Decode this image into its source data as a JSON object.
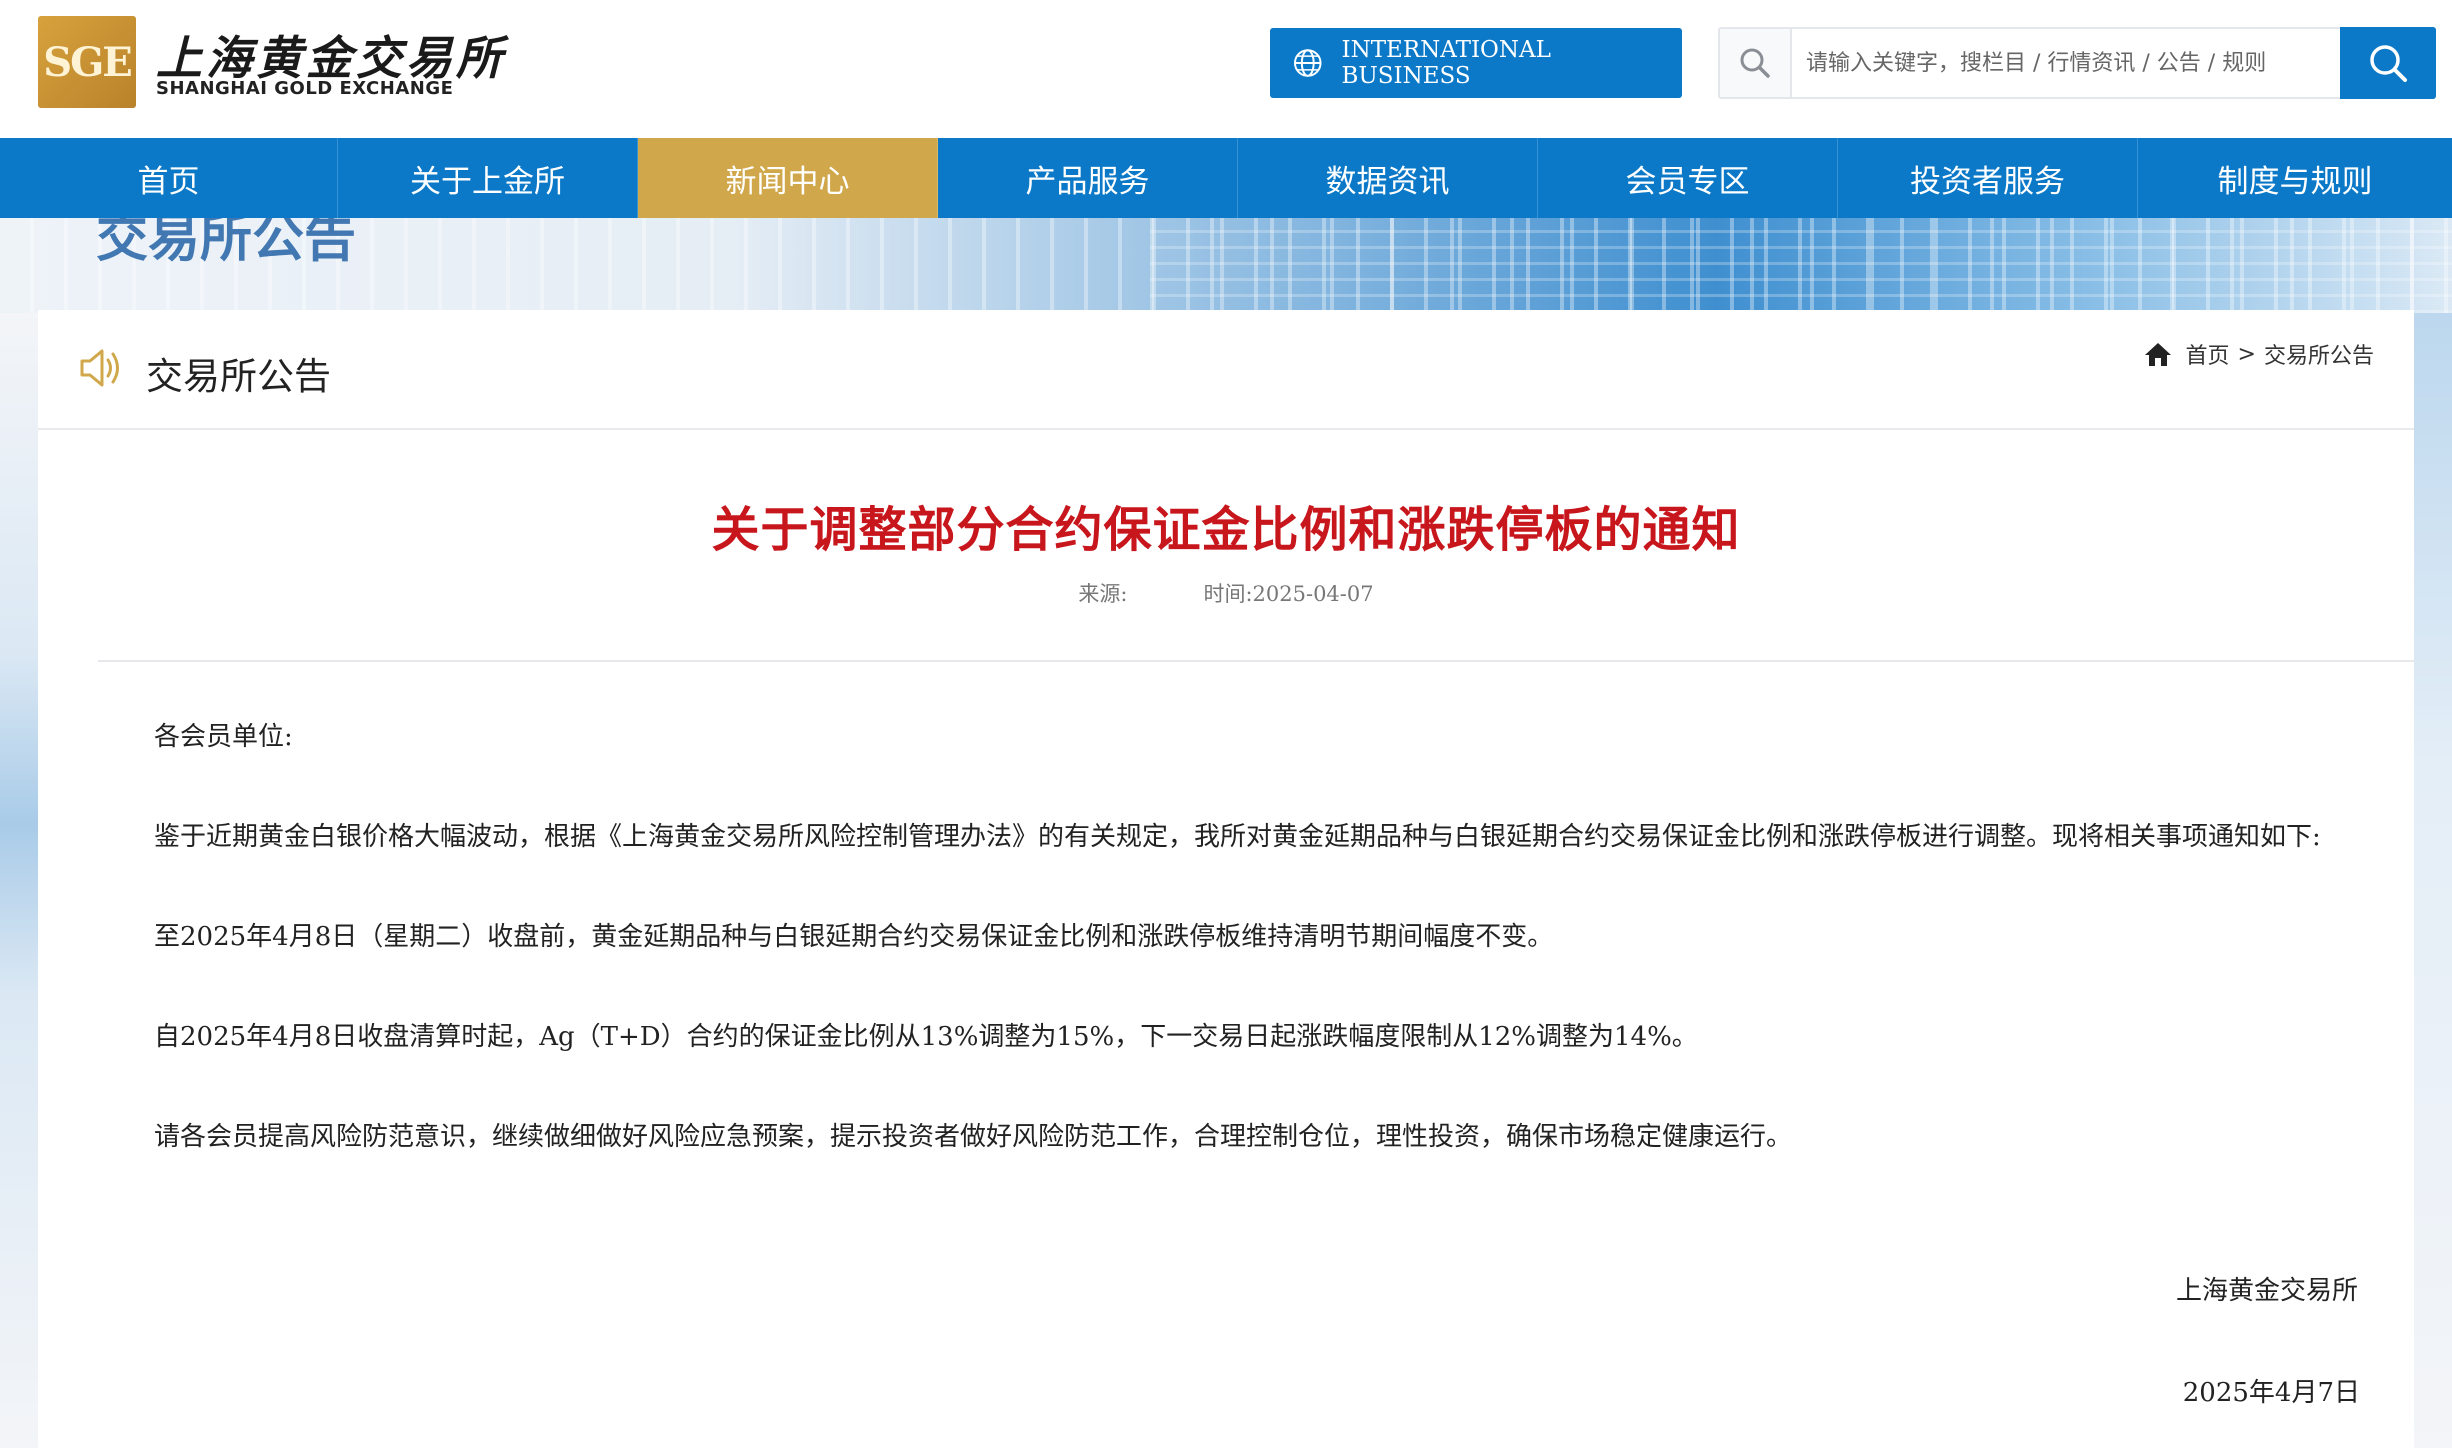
{
  "header": {
    "logo_mark": "SGE",
    "logo_cn": "上海黄金交易所",
    "logo_en": "SHANGHAI GOLD EXCHANGE",
    "intl_button": "INTERNATIONAL BUSINESS",
    "search_placeholder": "请输入关键字，搜栏目 / 行情资讯 / 公告 / 规则"
  },
  "nav": {
    "items": [
      {
        "label": "首页"
      },
      {
        "label": "关于上金所"
      },
      {
        "label": "新闻中心"
      },
      {
        "label": "产品服务"
      },
      {
        "label": "数据资讯"
      },
      {
        "label": "会员专区"
      },
      {
        "label": "投资者服务"
      },
      {
        "label": "制度与规则"
      }
    ],
    "active_index": 2
  },
  "banner": {
    "title": "交易所公告"
  },
  "section": {
    "title": "交易所公告",
    "breadcrumb": {
      "home": "首页",
      "separator": ">",
      "current": "交易所公告"
    }
  },
  "article": {
    "title": "关于调整部分合约保证金比例和涨跌停板的通知",
    "source_label": "来源:",
    "time_label": "时间:2025-04-07",
    "salutation": "各会员单位:",
    "paragraphs": [
      "鉴于近期黄金白银价格大幅波动，根据《上海黄金交易所风险控制管理办法》的有关规定，我所对黄金延期品种与白银延期合约交易保证金比例和涨跌停板进行调整。现将相关事项通知如下:",
      "至2025年4月8日（星期二）收盘前，黄金延期品种与白银延期合约交易保证金比例和涨跌停板维持清明节期间幅度不变。",
      "自2025年4月8日收盘清算时起，Ag（T+D）合约的保证金比例从13%调整为15%，下一交易日起涨跌幅度限制从12%调整为14%。",
      "请各会员提高风险防范意识，继续做细做好风险应急预案，提示投资者做好风险防范工作，合理控制仓位，理性投资，确保市场稳定健康运行。"
    ],
    "signature": "上海黄金交易所",
    "date": "2025年4月7日"
  },
  "colors": {
    "brand_blue": "#0b79c8",
    "active_gold": "#d0a84b",
    "title_red": "#c8161d"
  }
}
